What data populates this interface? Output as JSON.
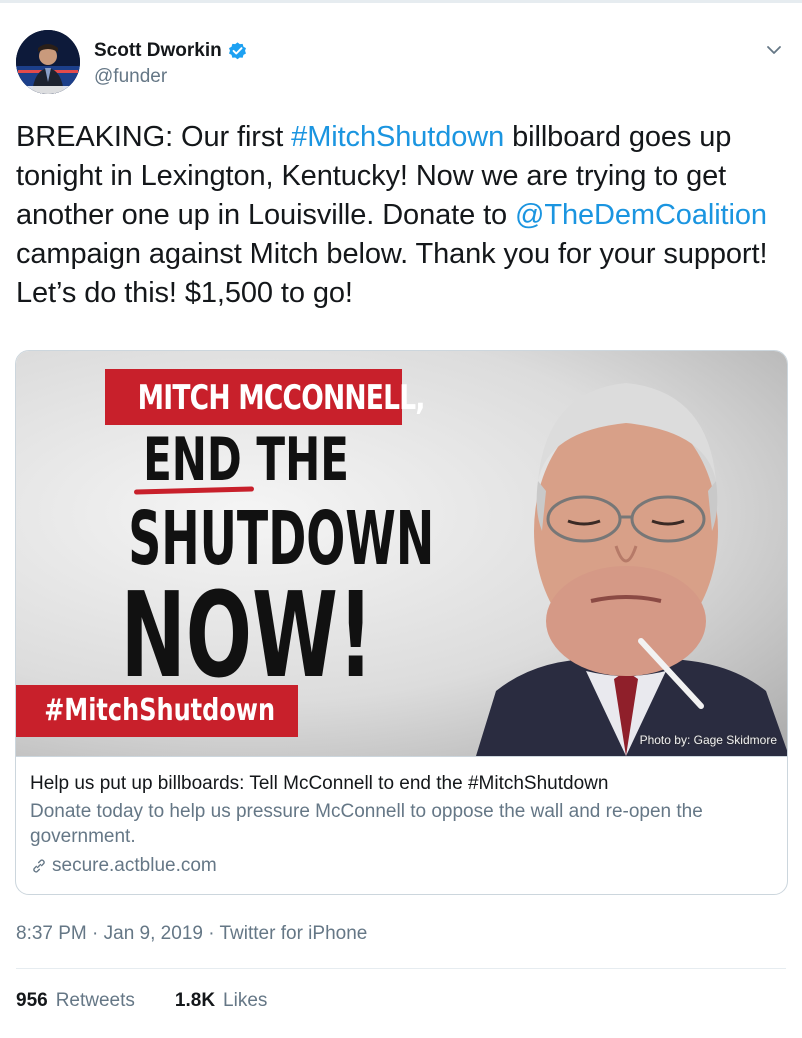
{
  "author": {
    "display_name": "Scott Dworkin",
    "handle": "@funder",
    "verified": true,
    "avatar_icon": "avatar-photo"
  },
  "tweet": {
    "segments": [
      {
        "text": "BREAKING: Our first ",
        "link": false
      },
      {
        "text": "#MitchShutdown",
        "link": true
      },
      {
        "text": " billboard goes up tonight in Lexington, Kentucky! Now we are trying to get another one up in Louisville. Donate to ",
        "link": false
      },
      {
        "text": "@TheDemCoalition",
        "link": true
      },
      {
        "text": " campaign against Mitch below. Thank you for your support!  Let’s do this! $1,500 to go!",
        "link": false
      }
    ],
    "link_color": "#1b95e0"
  },
  "card": {
    "image": {
      "banner_top": "MITCH MCCONNELL,",
      "line_end": "END THE",
      "line_shutdown": "SHUTDOWN",
      "line_now": "NOW!",
      "banner_bottom": "#MitchShutdown",
      "photo_credit": "Photo by: Gage Skidmore",
      "accent_color": "#c8202b"
    },
    "title": "Help us put up billboards: Tell McConnell to end the #MitchShutdown",
    "description": "Donate today to help us pressure McConnell to oppose the wall and re-open the government.",
    "url": "secure.actblue.com",
    "url_icon": "link-icon"
  },
  "meta": {
    "timestamp": "8:37 PM · Jan 9, 2019 · Twitter for iPhone"
  },
  "stats": {
    "retweets_count": "956",
    "retweets_label": "Retweets",
    "likes_count": "1.8K",
    "likes_label": "Likes"
  }
}
